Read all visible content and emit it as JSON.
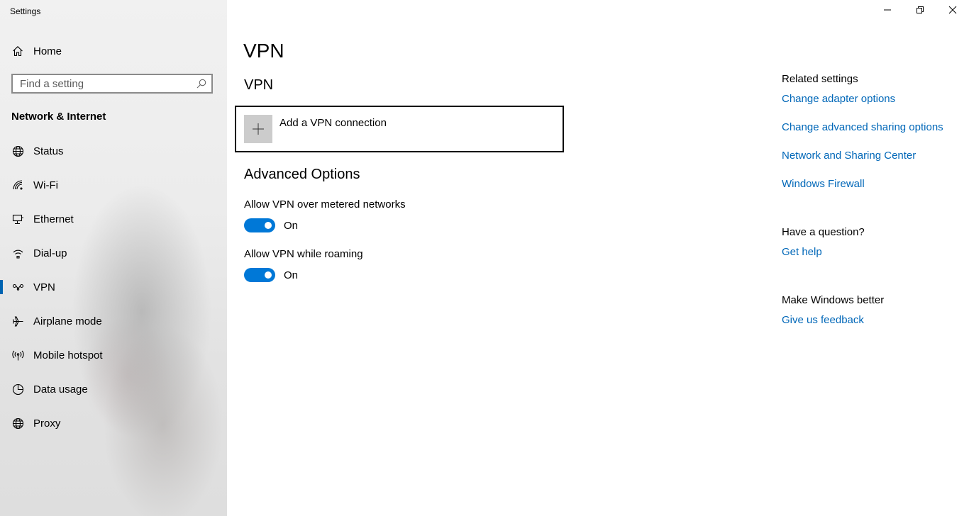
{
  "window": {
    "title": "Settings",
    "controls": {
      "minimize": "minimize-icon",
      "restore": "restore-icon",
      "close": "close-icon"
    }
  },
  "sidebar": {
    "home_label": "Home",
    "search_placeholder": "Find a setting",
    "section_heading": "Network & Internet",
    "items": [
      {
        "label": "Status",
        "icon": "globe-status-icon"
      },
      {
        "label": "Wi-Fi",
        "icon": "wifi-icon"
      },
      {
        "label": "Ethernet",
        "icon": "ethernet-icon"
      },
      {
        "label": "Dial-up",
        "icon": "dialup-icon"
      },
      {
        "label": "VPN",
        "icon": "vpn-icon",
        "selected": true
      },
      {
        "label": "Airplane mode",
        "icon": "airplane-icon"
      },
      {
        "label": "Mobile hotspot",
        "icon": "hotspot-icon"
      },
      {
        "label": "Data usage",
        "icon": "data-usage-icon"
      },
      {
        "label": "Proxy",
        "icon": "globe-icon"
      }
    ]
  },
  "main": {
    "page_title": "VPN",
    "vpn_section_title": "VPN",
    "add_vpn_label": "Add a VPN connection",
    "advanced_title": "Advanced Options",
    "options": [
      {
        "label": "Allow VPN over metered networks",
        "state": "On",
        "enabled": true
      },
      {
        "label": "Allow VPN while roaming",
        "state": "On",
        "enabled": true
      }
    ]
  },
  "related": {
    "heading": "Related settings",
    "links": [
      "Change adapter options",
      "Change advanced sharing options",
      "Network and Sharing Center",
      "Windows Firewall"
    ],
    "question_heading": "Have a question?",
    "help_link": "Get help",
    "feedback_heading": "Make Windows better",
    "feedback_link": "Give us feedback"
  },
  "colors": {
    "accent": "#0078d7",
    "link": "#0067b8",
    "selection_bar": "#0063b1"
  }
}
